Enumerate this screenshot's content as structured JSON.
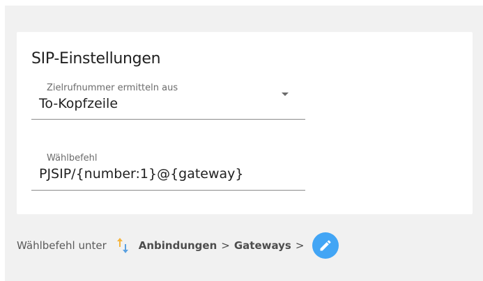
{
  "section": {
    "title": "SIP-Einstellungen"
  },
  "fields": {
    "destination": {
      "label": "Zielrufnummer ermitteln aus",
      "value": "To-Kopfzeile",
      "icon": "arrow-drop-down-icon"
    },
    "dial_command": {
      "label": "Wählbefehl",
      "value": "PJSIP/{number:1}@{gateway}"
    }
  },
  "hint": {
    "prefix": "Wählbefehl unter",
    "sort_icon": "sort-arrows-icon",
    "crumb1": "Anbindungen",
    "separator1": ">",
    "crumb2": "Gateways",
    "separator2": ">",
    "edit_icon": "pencil-edit-icon"
  },
  "colors": {
    "background": "#f1f1f1",
    "card": "#ffffff",
    "accent": "#42a5f5",
    "sort_up": "#f5b43c",
    "sort_down": "#5aa0e0"
  }
}
